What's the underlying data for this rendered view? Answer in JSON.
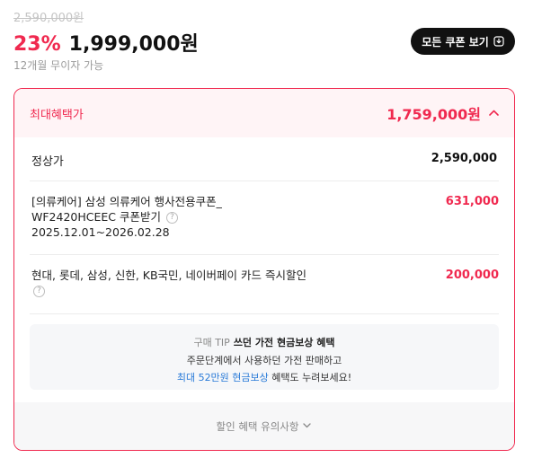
{
  "price": {
    "original": "2,590,000원",
    "discount_rate": "23%",
    "sale": "1,999,000원",
    "installment": "12개월 무이자 가능"
  },
  "coupon_button": {
    "label": "모든 쿠폰 보기",
    "icon": "download-icon"
  },
  "benefit": {
    "header_label": "최대혜택가",
    "max_price": "1,759,000원",
    "toggle_icon": "chevron-up-icon",
    "regular_label": "정상가",
    "regular_value": "2,590,000",
    "coupon_line1": "[의류케어] 삼성 의류케어 행사전용쿠폰_",
    "coupon_line2": "WF2420HCEEC 쿠폰받기",
    "coupon_period": "2025.12.01~2026.02.28",
    "coupon_value": "631,000",
    "card_label": "현대, 롯데, 삼성, 신한, KB국민, 네이버페이 카드 즉시할인",
    "card_value": "200,000",
    "help_icon": "?"
  },
  "tip": {
    "tag": "구매 TIP",
    "title": "쓰던 가전 현금보상 혜택",
    "line2": "주문단계에서 사용하던 가전 판매하고",
    "link": "최대 52만원 현금보상",
    "line3_suffix": " 혜택도 누려보세요!"
  },
  "footer": {
    "label": "할인 혜택 유의사항",
    "icon": "chevron-down-icon"
  },
  "colors": {
    "accent": "#f0294f",
    "link": "#2a7bd8",
    "dark_button": "#111111"
  }
}
